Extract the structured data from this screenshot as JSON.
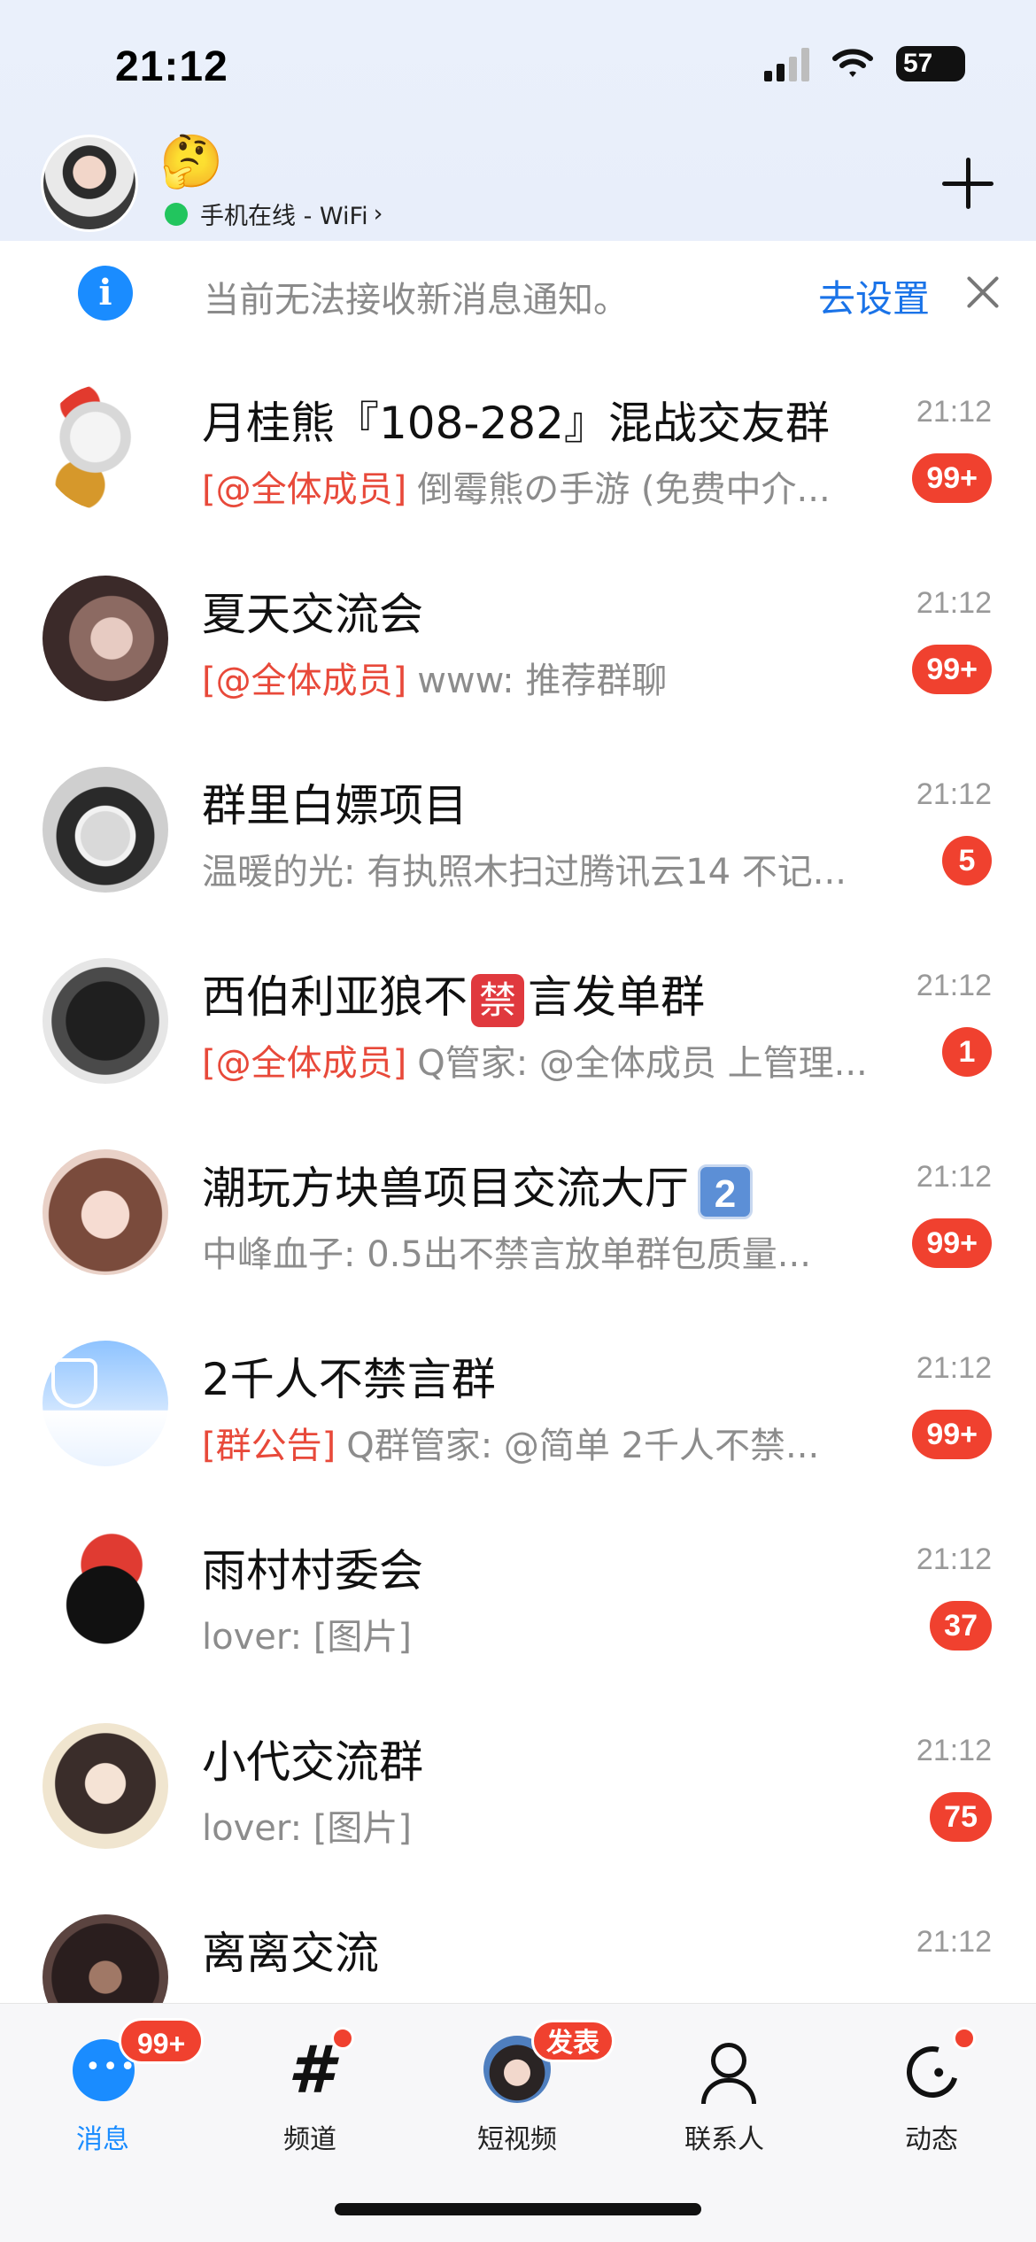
{
  "status_bar": {
    "time": "21:12",
    "battery_level": "57"
  },
  "header": {
    "emoji": "🤔",
    "online_status": "手机在线 - WiFi",
    "chevron": "›"
  },
  "notice": {
    "info_glyph": "i",
    "text": "当前无法接收新消息通知。",
    "action": "去设置"
  },
  "conversations": [
    {
      "name": "月桂熊『108-282』混战交友群",
      "tag": "[@全体成员]",
      "preview": "倒霉熊の手游 (免费中介...",
      "time": "21:12",
      "badge": "99+"
    },
    {
      "name": "夏天交流会",
      "tag": "[@全体成员]",
      "preview": "www: 推荐群聊",
      "time": "21:12",
      "badge": "99+"
    },
    {
      "name": "群里白嫖项目",
      "tag": "",
      "preview": "温暖的光: 有执照木扫过腾讯云14 不记...",
      "time": "21:12",
      "badge": "5"
    },
    {
      "name_before": "西伯利亚狼不",
      "name_mark": "禁",
      "name_after": "言发单群",
      "tag": "[@全体成员]",
      "preview": "Q管家: @全体成员 上管理...",
      "time": "21:12",
      "badge": "1"
    },
    {
      "name": "潮玩方块兽项目交流大厅",
      "name_mark": "2",
      "tag": "",
      "preview": "中峰血子: 0.5出不禁言放单群包质量...",
      "time": "21:12",
      "badge": "99+"
    },
    {
      "name": "2千人不禁言群",
      "tag": "[群公告]",
      "preview": "Q群管家: @简单 2千人不禁...",
      "time": "21:12",
      "badge": "99+"
    },
    {
      "name": "雨村村委会",
      "tag": "",
      "preview": "lover: [图片]",
      "time": "21:12",
      "badge": "37"
    },
    {
      "name": "小代交流群",
      "tag": "",
      "preview": "lover: [图片]",
      "time": "21:12",
      "badge": "75"
    },
    {
      "name": "离离交流",
      "tag": "",
      "preview": "",
      "time": "21:12",
      "badge": ""
    }
  ],
  "tabbar": {
    "tabs": [
      {
        "label": "消息",
        "icon": "message-bubble-icon",
        "badge": "99+",
        "active": true
      },
      {
        "label": "频道",
        "icon": "channel-hash-icon",
        "badge": "",
        "active": false
      },
      {
        "label": "短视频",
        "icon": "short-video-avatar-icon",
        "badge": "发表",
        "active": false
      },
      {
        "label": "联系人",
        "icon": "contacts-person-icon",
        "badge": "",
        "active": false
      },
      {
        "label": "动态",
        "icon": "dynamic-icon",
        "badge": "",
        "active": false
      }
    ],
    "channel_hash": "#"
  },
  "colors": {
    "accent": "#1a8cff",
    "badge": "#f0412f",
    "mention": "#e8493a",
    "link": "#1a73e8"
  }
}
